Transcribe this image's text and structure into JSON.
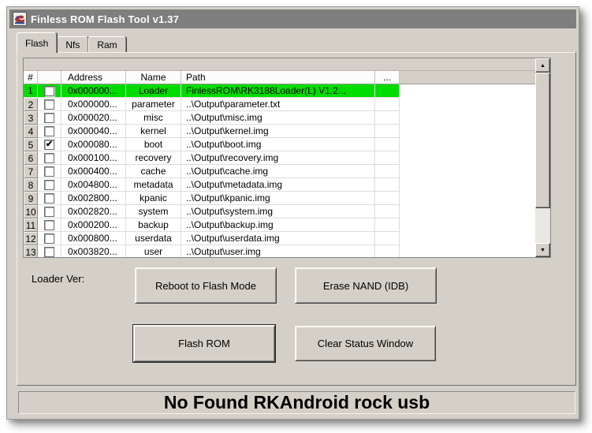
{
  "window": {
    "title": "Finless ROM Flash Tool v1.37"
  },
  "tabs": [
    {
      "label": "Flash",
      "active": true
    },
    {
      "label": "Nfs",
      "active": false
    },
    {
      "label": "Ram",
      "active": false
    }
  ],
  "grid": {
    "columns": [
      "#",
      "",
      "Address",
      "Name",
      "Path",
      "..."
    ],
    "rows": [
      {
        "num": "1",
        "checked": false,
        "address": "0x000000...",
        "name": "Loader",
        "path": "FinlessROM\\RK3188Loader(L)  V1.2...",
        "highlight": true
      },
      {
        "num": "2",
        "checked": false,
        "address": "0x000000...",
        "name": "parameter",
        "path": "..\\Output\\parameter.txt",
        "highlight": false
      },
      {
        "num": "3",
        "checked": false,
        "address": "0x000020...",
        "name": "misc",
        "path": "..\\Output\\misc.img",
        "highlight": false
      },
      {
        "num": "4",
        "checked": false,
        "address": "0x000040...",
        "name": "kernel",
        "path": "..\\Output\\kernel.img",
        "highlight": false
      },
      {
        "num": "5",
        "checked": true,
        "address": "0x000080...",
        "name": "boot",
        "path": "..\\Output\\boot.img",
        "highlight": false
      },
      {
        "num": "6",
        "checked": false,
        "address": "0x000100...",
        "name": "recovery",
        "path": "..\\Output\\recovery.img",
        "highlight": false
      },
      {
        "num": "7",
        "checked": false,
        "address": "0x000400...",
        "name": "cache",
        "path": "..\\Output\\cache.img",
        "highlight": false
      },
      {
        "num": "8",
        "checked": false,
        "address": "0x004800...",
        "name": "metadata",
        "path": "..\\Output\\metadata.img",
        "highlight": false
      },
      {
        "num": "9",
        "checked": false,
        "address": "0x002800...",
        "name": "kpanic",
        "path": "..\\Output\\kpanic.img",
        "highlight": false
      },
      {
        "num": "10",
        "checked": false,
        "address": "0x002820...",
        "name": "system",
        "path": "..\\Output\\system.img",
        "highlight": false
      },
      {
        "num": "11",
        "checked": false,
        "address": "0x000200...",
        "name": "backup",
        "path": "..\\Output\\backup.img",
        "highlight": false
      },
      {
        "num": "12",
        "checked": false,
        "address": "0x000800...",
        "name": "userdata",
        "path": "..\\Output\\userdata.img",
        "highlight": false
      },
      {
        "num": "13",
        "checked": false,
        "address": "0x003820...",
        "name": "user",
        "path": "..\\Output\\user.img",
        "highlight": false
      }
    ]
  },
  "controls": {
    "loader_ver_label": "Loader Ver:",
    "reboot_button": "Reboot to Flash Mode",
    "erase_button": "Erase NAND (IDB)",
    "flash_button": "Flash ROM",
    "clear_button": "Clear Status Window"
  },
  "status": {
    "message": "No Found RKAndroid rock usb"
  },
  "icons": {
    "check_glyph": "✔",
    "scroll_up_glyph": "▲",
    "scroll_down_glyph": "▼"
  },
  "colors": {
    "highlight_green": "#00dc00",
    "titlebar_gray": "#7e7e7e",
    "face": "#d4d0c8"
  }
}
